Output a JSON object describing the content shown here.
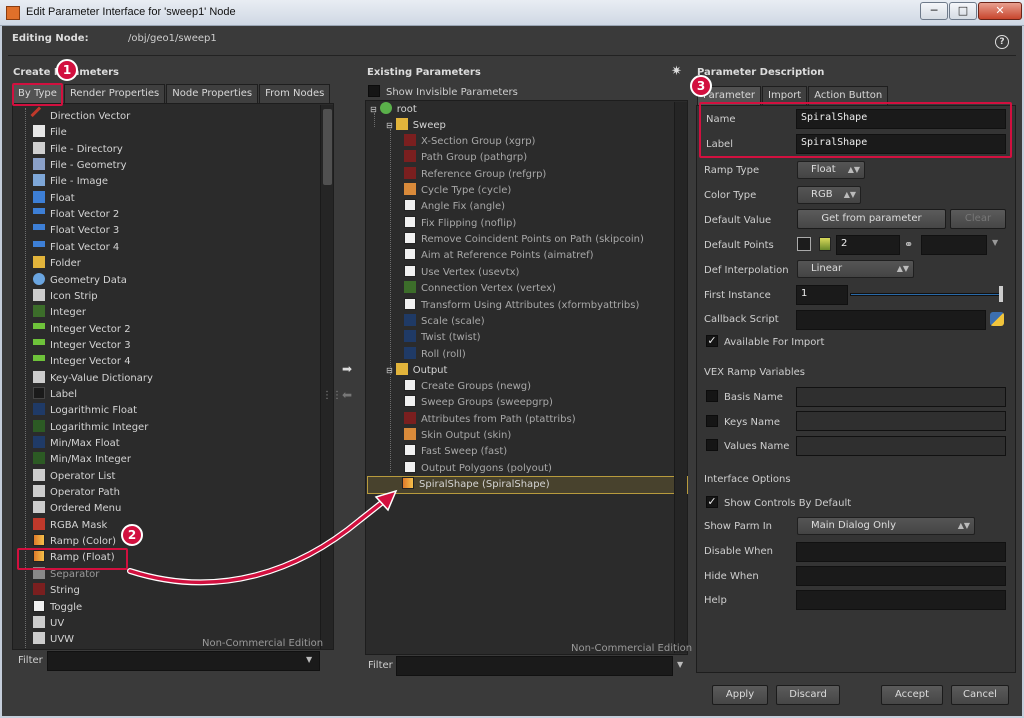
{
  "window": {
    "title": "Edit Parameter Interface for 'sweep1' Node",
    "minimize": "─",
    "maximize": "□",
    "close": "✕"
  },
  "editing": {
    "label": "Editing Node:",
    "path": "/obj/geo1/sweep1",
    "help": "?"
  },
  "left": {
    "header": "Create Parameters",
    "tabs": [
      "By Type",
      "Render Properties",
      "Node Properties",
      "From Nodes"
    ],
    "items": [
      {
        "label": "Direction Vector",
        "icon": "arrow-icon",
        "color": "#c0392b"
      },
      {
        "label": "File",
        "icon": "file-icon",
        "color": "#e6e6e6"
      },
      {
        "label": "File - Directory",
        "icon": "dir-icon",
        "color": "#cfcfcf"
      },
      {
        "label": "File - Geometry",
        "icon": "geometry-icon",
        "color": "#8aa0c8"
      },
      {
        "label": "File - Image",
        "icon": "image-icon",
        "color": "#7ea7d8"
      },
      {
        "label": "Float",
        "icon": "float-icon",
        "color": "#3d7fd6"
      },
      {
        "label": "Float Vector 2",
        "icon": "vector-icon",
        "color": "#3d7fd6"
      },
      {
        "label": "Float Vector 3",
        "icon": "vector-icon",
        "color": "#3d7fd6"
      },
      {
        "label": "Float Vector 4",
        "icon": "vector-icon",
        "color": "#3d7fd6"
      },
      {
        "label": "Folder",
        "icon": "folder-icon",
        "color": "#e2b43b"
      },
      {
        "label": "Geometry Data",
        "icon": "geometry-data-icon",
        "color": "#6aa5e0"
      },
      {
        "label": "Icon Strip",
        "icon": "icon-strip-icon",
        "color": "#cccccc"
      },
      {
        "label": "Integer",
        "icon": "integer-icon",
        "color": "#3c6d2a"
      },
      {
        "label": "Integer Vector 2",
        "icon": "int-vector-icon",
        "color": "#6ec23a"
      },
      {
        "label": "Integer Vector 3",
        "icon": "int-vector-icon",
        "color": "#6ec23a"
      },
      {
        "label": "Integer Vector 4",
        "icon": "int-vector-icon",
        "color": "#6ec23a"
      },
      {
        "label": "Key-Value Dictionary",
        "icon": "dictionary-icon",
        "color": "#cccccc"
      },
      {
        "label": "Label",
        "icon": "label-icon",
        "color": "#222222"
      },
      {
        "label": "Logarithmic Float",
        "icon": "log-float-icon",
        "color": "#1f3a66"
      },
      {
        "label": "Logarithmic Integer",
        "icon": "log-int-icon",
        "color": "#2c5a24"
      },
      {
        "label": "Min/Max Float",
        "icon": "minmax-float-icon",
        "color": "#1f3a66"
      },
      {
        "label": "Min/Max Integer",
        "icon": "minmax-int-icon",
        "color": "#2c5a24"
      },
      {
        "label": "Operator List",
        "icon": "operator-list-icon",
        "color": "#cccccc"
      },
      {
        "label": "Operator Path",
        "icon": "operator-path-icon",
        "color": "#cccccc"
      },
      {
        "label": "Ordered Menu",
        "icon": "menu-icon",
        "color": "#cccccc"
      },
      {
        "label": "RGBA Mask",
        "icon": "rgba-icon",
        "color": "#c0392b"
      },
      {
        "label": "Ramp (Color)",
        "icon": "ramp-color-icon",
        "color": "#e07a2a"
      },
      {
        "label": "Ramp (Float)",
        "icon": "ramp-float-icon",
        "color": "#e07a2a"
      },
      {
        "label": "Separator",
        "icon": "separator-icon",
        "color": "#888888"
      },
      {
        "label": "String",
        "icon": "string-icon",
        "color": "#7a1f1f"
      },
      {
        "label": "Toggle",
        "icon": "toggle-icon",
        "color": "#eeeeee"
      },
      {
        "label": "UV",
        "icon": "uv-icon",
        "color": "#cccccc"
      },
      {
        "label": "UVW",
        "icon": "uvw-icon",
        "color": "#cccccc"
      }
    ],
    "watermark": "Non-Commercial Edition",
    "filter_label": "Filter"
  },
  "middle": {
    "header": "Existing Parameters",
    "show_invisible": "Show Invisible Parameters",
    "root": "root",
    "sweep_folder": "Sweep",
    "sweep_items": [
      {
        "label": "X-Section Group (xgrp)",
        "icon": "string-icon",
        "dim": true
      },
      {
        "label": "Path Group (pathgrp)",
        "icon": "string-icon",
        "dim": true
      },
      {
        "label": "Reference Group (refgrp)",
        "icon": "string-icon",
        "dim": true
      },
      {
        "label": "Cycle Type (cycle)",
        "icon": "menu-icon",
        "dim": true
      },
      {
        "label": "Angle Fix (angle)",
        "icon": "toggle-icon",
        "dim": true
      },
      {
        "label": "Fix Flipping (noflip)",
        "icon": "toggle-icon",
        "dim": true
      },
      {
        "label": "Remove Coincident Points on Path (skipcoin)",
        "icon": "toggle-icon",
        "dim": true
      },
      {
        "label": "Aim at Reference Points (aimatref)",
        "icon": "toggle-icon",
        "dim": true
      },
      {
        "label": "Use Vertex (usevtx)",
        "icon": "toggle-icon",
        "dim": true
      },
      {
        "label": "Connection Vertex (vertex)",
        "icon": "integer-icon",
        "dim": true
      },
      {
        "label": "Transform Using Attributes (xformbyattribs)",
        "icon": "toggle-icon",
        "dim": true
      },
      {
        "label": "Scale (scale)",
        "icon": "float-icon",
        "dim": true
      },
      {
        "label": "Twist (twist)",
        "icon": "float-icon",
        "dim": true
      },
      {
        "label": "Roll (roll)",
        "icon": "float-icon",
        "dim": true
      }
    ],
    "output_folder": "Output",
    "output_items": [
      {
        "label": "Create Groups (newg)",
        "icon": "toggle-icon"
      },
      {
        "label": "Sweep Groups (sweepgrp)",
        "icon": "toggle-icon"
      },
      {
        "label": "Attributes from Path (ptattribs)",
        "icon": "string-icon"
      },
      {
        "label": "Skin Output (skin)",
        "icon": "menu-icon"
      },
      {
        "label": "Fast Sweep (fast)",
        "icon": "toggle-icon"
      },
      {
        "label": "Output Polygons (polyout)",
        "icon": "toggle-icon"
      }
    ],
    "selected_item": "SpiralShape (SpiralShape)",
    "watermark": "Non-Commercial Edition",
    "filter_label": "Filter"
  },
  "right": {
    "header": "Parameter Description",
    "tabs": [
      "Parameter",
      "Import",
      "Action Button"
    ],
    "name_label": "Name",
    "name_value": "SpiralShape",
    "label_label": "Label",
    "label_value": "SpiralShape",
    "ramp_type_label": "Ramp Type",
    "ramp_type_value": "Float",
    "color_type_label": "Color Type",
    "color_type_value": "RGB",
    "default_value_label": "Default Value",
    "get_from_parameter": "Get from parameter",
    "clear": "Clear",
    "default_points_label": "Default Points",
    "default_points_value": "2",
    "def_interp_label": "Def Interpolation",
    "def_interp_value": "Linear",
    "first_instance_label": "First Instance",
    "first_instance_value": "1",
    "callback_label": "Callback Script",
    "available_for_import": "Available For Import",
    "vex_ramp_header": "VEX Ramp Variables",
    "basis_name": "Basis Name",
    "keys_name": "Keys Name",
    "values_name": "Values Name",
    "interface_options": "Interface Options",
    "show_controls": "Show Controls By Default",
    "show_parm_in_label": "Show Parm In",
    "show_parm_in_value": "Main Dialog Only",
    "disable_when": "Disable When",
    "hide_when": "Hide When",
    "help": "Help"
  },
  "footer": {
    "apply": "Apply",
    "discard": "Discard",
    "accept": "Accept",
    "cancel": "Cancel"
  },
  "annotations": {
    "badge1": "1",
    "badge2": "2",
    "badge3": "3",
    "color": "#d2103f"
  }
}
